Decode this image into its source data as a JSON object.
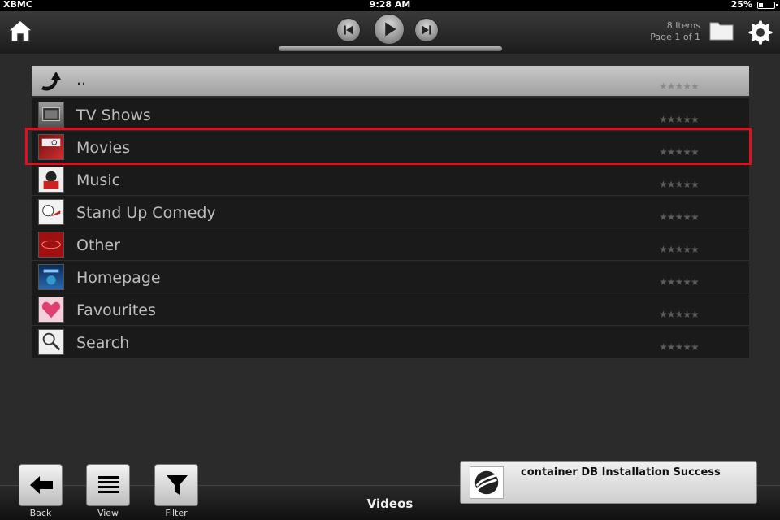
{
  "status_bar": {
    "carrier": "XBMC",
    "time": "9:28 AM",
    "battery": "25%"
  },
  "header": {
    "items_count": "8 Items",
    "page": "Page 1 of 1"
  },
  "list": {
    "parent_label": "..",
    "items": [
      {
        "label": "TV Shows",
        "icon": "tv-icon",
        "color": "#777777"
      },
      {
        "label": "Movies",
        "icon": "movie-icon",
        "color": "#b02020",
        "selected": true
      },
      {
        "label": "Music",
        "icon": "music-icon",
        "color": "#cc2222"
      },
      {
        "label": "Stand Up Comedy",
        "icon": "comedy-icon",
        "color": "#dddddd"
      },
      {
        "label": "Other",
        "icon": "other-icon",
        "color": "#aa1111"
      },
      {
        "label": "Homepage",
        "icon": "homepage-icon",
        "color": "#2266aa"
      },
      {
        "label": "Favourites",
        "icon": "favourites-icon",
        "color": "#e06080"
      },
      {
        "label": "Search",
        "icon": "search-icon",
        "color": "#cccccc"
      }
    ],
    "rating_stars": "★★★★★"
  },
  "bottom": {
    "back_label": "Back",
    "view_label": "View",
    "filter_label": "Filter",
    "section_title": "Videos",
    "notification": "container DB Installation Success"
  },
  "colors": {
    "highlight": "#e01020",
    "row_bg": "#1a1a1a"
  }
}
